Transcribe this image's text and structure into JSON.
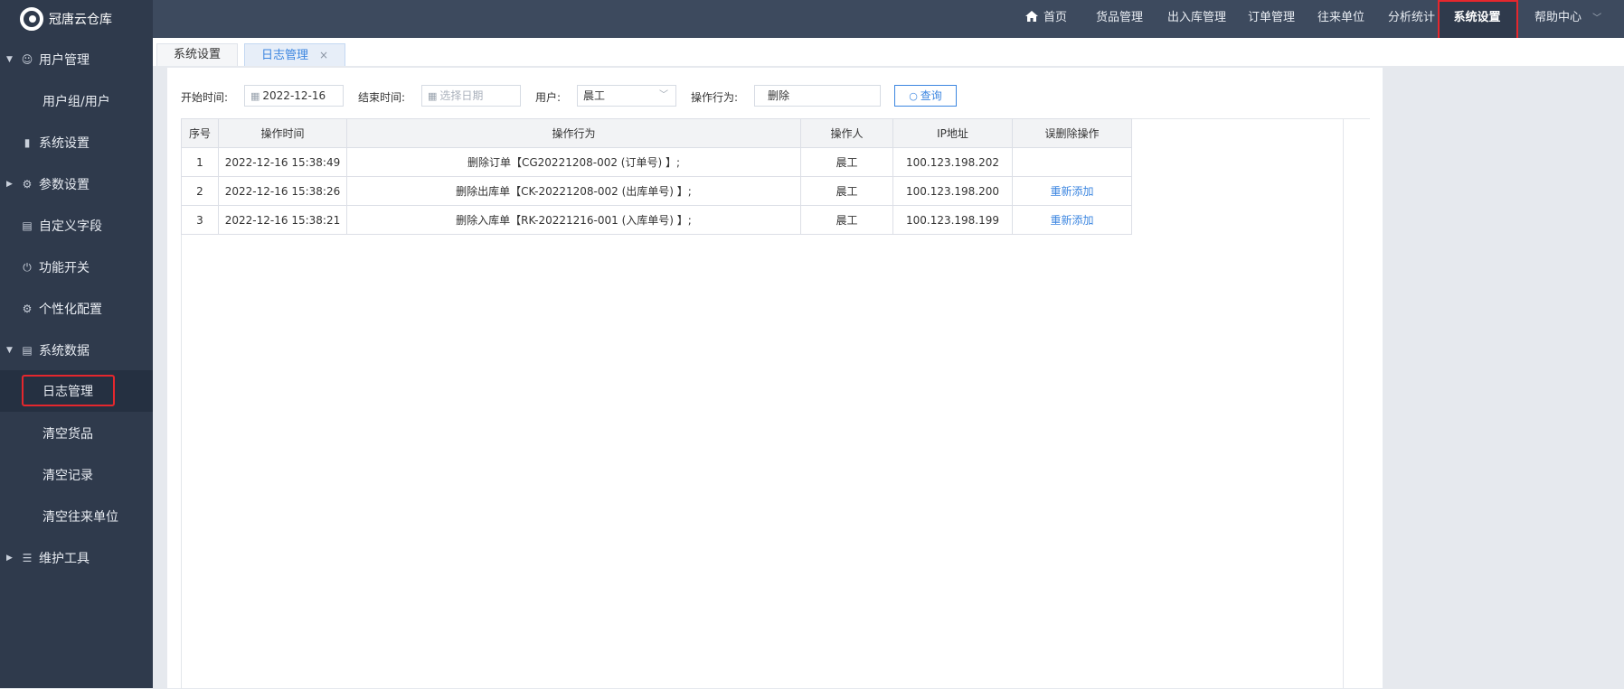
{
  "app": {
    "name": "冠唐云仓库"
  },
  "topnav": {
    "items": [
      "首页",
      "货品管理",
      "出入库管理",
      "订单管理",
      "往来单位",
      "分析统计",
      "系统设置",
      "帮助中心"
    ],
    "active": "系统设置"
  },
  "sidebar": {
    "items": [
      {
        "label": "用户管理",
        "icon": "user-icon",
        "expandable": true
      },
      {
        "label": "用户组/用户",
        "sub": true
      },
      {
        "label": "系统设置",
        "icon": "monitor-icon"
      },
      {
        "label": "参数设置",
        "icon": "gear-icon",
        "expandable": true
      },
      {
        "label": "自定义字段",
        "icon": "document-icon"
      },
      {
        "label": "功能开关",
        "icon": "power-icon"
      },
      {
        "label": "个性化配置",
        "icon": "gear-icon"
      },
      {
        "label": "系统数据",
        "icon": "database-icon",
        "expandable": true
      },
      {
        "label": "日志管理",
        "sub": true,
        "active": true
      },
      {
        "label": "清空货品",
        "sub": true
      },
      {
        "label": "清空记录",
        "sub": true
      },
      {
        "label": "清空往来单位",
        "sub": true
      },
      {
        "label": "维护工具",
        "icon": "stack-icon",
        "expandable": true
      }
    ]
  },
  "tabs": [
    {
      "label": "系统设置"
    },
    {
      "label": "日志管理",
      "active": true,
      "close": "×"
    }
  ],
  "filters": {
    "start_label": "开始时间:",
    "start_value": "2022-12-16",
    "end_label": "结束时间:",
    "end_placeholder": "选择日期",
    "user_label": "用户:",
    "user_value": "晨工",
    "action_label": "操作行为:",
    "action_value": "删除",
    "query_button": "查询"
  },
  "table": {
    "headers": [
      "序号",
      "操作时间",
      "操作行为",
      "操作人",
      "IP地址",
      "误删除操作"
    ],
    "rows": [
      [
        "1",
        "2022-12-16 15:38:49",
        "删除订单【CG20221208-002 (订单号) 】;",
        "晨工",
        "100.123.198.202",
        ""
      ],
      [
        "2",
        "2022-12-16 15:38:26",
        "删除出库单【CK-20221208-002 (出库单号) 】;",
        "晨工",
        "100.123.198.200",
        "重新添加"
      ],
      [
        "3",
        "2022-12-16 15:38:21",
        "删除入库单【RK-20221216-001 (入库单号) 】;",
        "晨工",
        "100.123.198.199",
        "重新添加"
      ]
    ]
  },
  "colors": {
    "sidebar": "#2f3a4c",
    "topbar": "#3d4a5e",
    "accent": "#3c86e0",
    "highlight": "#e5272d"
  }
}
